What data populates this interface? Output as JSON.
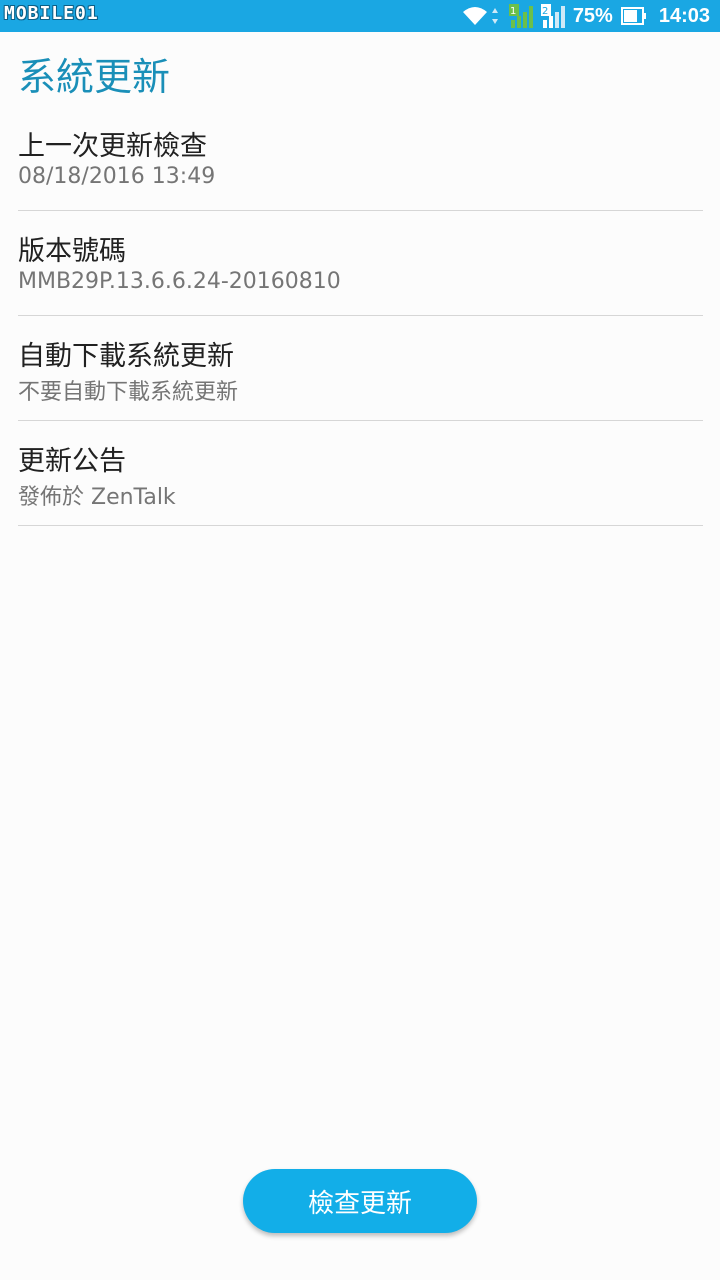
{
  "status_bar": {
    "watermark": "MOBILE01",
    "battery_percent": "75%",
    "time": "14:03",
    "icons": [
      "wifi-icon",
      "data-arrows-icon",
      "signal-sim1-icon",
      "signal-sim2-icon",
      "battery-icon"
    ],
    "colors": {
      "background": "#1aa7e3",
      "sim1_signal": "#6cc04a"
    }
  },
  "header": {
    "title": "系統更新"
  },
  "settings": {
    "items": [
      {
        "title": "上一次更新檢查",
        "subtitle": "08/18/2016 13:49"
      },
      {
        "title": "版本號碼",
        "subtitle": "MMB29P.13.6.6.24-20160810"
      },
      {
        "title": "自動下載系統更新",
        "subtitle": "不要自動下載系統更新"
      },
      {
        "title": "更新公告",
        "subtitle": "發佈於 ZenTalk"
      }
    ]
  },
  "action": {
    "check_update_label": "檢查更新"
  },
  "theme": {
    "accent": "#1a8fb8",
    "button": "#12aee8"
  }
}
